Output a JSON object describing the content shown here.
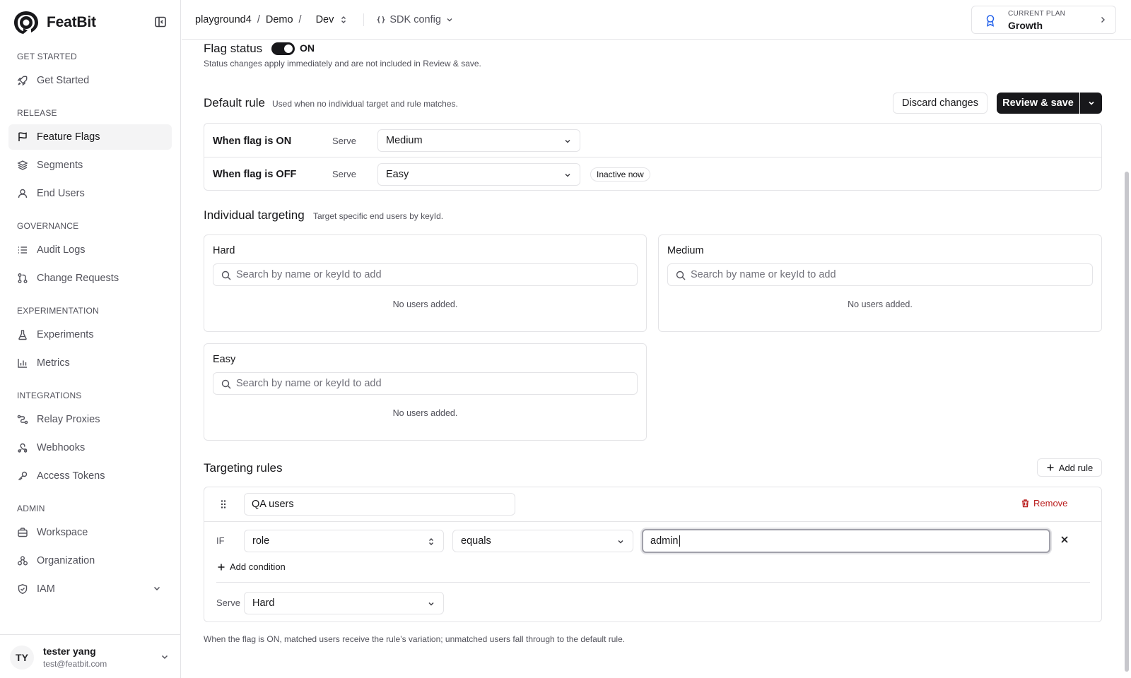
{
  "app": {
    "name": "FeatBit"
  },
  "sidebar": {
    "sections": {
      "get_started": "GET STARTED",
      "release": "RELEASE",
      "governance": "GOVERNANCE",
      "experimentation": "EXPERIMENTATION",
      "integrations": "INTEGRATIONS",
      "admin": "ADMIN"
    },
    "items": {
      "get_started": "Get Started",
      "feature_flags": "Feature Flags",
      "segments": "Segments",
      "end_users": "End Users",
      "audit_logs": "Audit Logs",
      "change_requests": "Change Requests",
      "experiments": "Experiments",
      "metrics": "Metrics",
      "relay_proxies": "Relay Proxies",
      "webhooks": "Webhooks",
      "access_tokens": "Access Tokens",
      "workspace": "Workspace",
      "organization": "Organization",
      "iam": "IAM"
    },
    "active": "feature_flags",
    "user": {
      "initials": "TY",
      "name": "tester yang",
      "email": "test@featbit.com"
    }
  },
  "header": {
    "breadcrumb": [
      "playground4",
      "Demo"
    ],
    "env": "Dev",
    "sdk_config": "SDK config",
    "plan": {
      "caption": "CURRENT PLAN",
      "value": "Growth"
    }
  },
  "flag_status": {
    "title": "Flag status",
    "state": "ON",
    "note": "Status changes apply immediately and are not included in Review & save."
  },
  "default_rule": {
    "title": "Default rule",
    "subtitle": "Used when no individual target and rule matches.",
    "discard_label": "Discard changes",
    "review_label": "Review & save",
    "on_label": "When flag is ON",
    "off_label": "When flag is OFF",
    "serve_label": "Serve",
    "on_value": "Medium",
    "off_value": "Easy",
    "inactive_badge": "Inactive now"
  },
  "individual_targeting": {
    "title": "Individual targeting",
    "subtitle": "Target specific end users by keyId.",
    "placeholder": "Search by name or keyId to add",
    "empty": "No users added.",
    "groups": [
      "Hard",
      "Medium",
      "Easy"
    ]
  },
  "targeting_rules": {
    "title": "Targeting rules",
    "add_rule_label": "Add rule",
    "rule": {
      "name": "QA users",
      "remove_label": "Remove",
      "if_label": "IF",
      "attribute": "role",
      "operator": "equals",
      "value": "admin",
      "add_condition_label": "Add condition",
      "serve_label": "Serve",
      "serve_value": "Hard"
    },
    "footnote": "When the flag is ON, matched users receive the rule’s variation; unmatched users fall through to the default rule."
  },
  "colors": {
    "primary": "#18181b",
    "danger": "#b91c1c",
    "border": "#e4e4e7",
    "muted": "#52525b",
    "plan_icon": "#2563eb"
  }
}
